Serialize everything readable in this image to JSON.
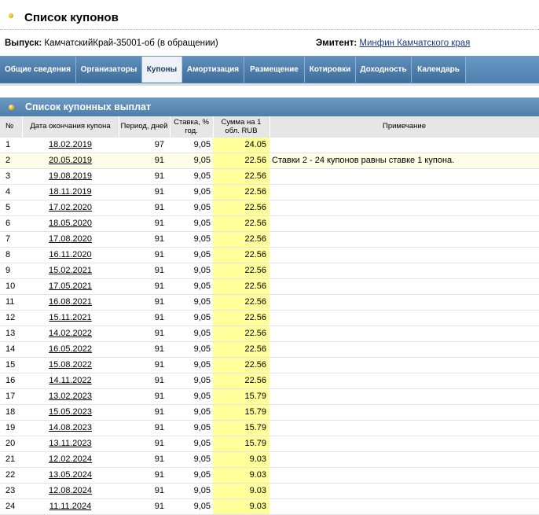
{
  "page": {
    "title": "Список купонов",
    "issue_label": "Выпуск:",
    "issue_value": "КамчатскийКрай-35001-об (в обращении)",
    "issuer_label": "Эмитент:",
    "issuer_link": "Минфин Камчатского края"
  },
  "tabs": [
    {
      "label": "Общие сведения",
      "active": false
    },
    {
      "label": "Организаторы",
      "active": false
    },
    {
      "label": "Купоны",
      "active": true
    },
    {
      "label": "Амортизация",
      "active": false
    },
    {
      "label": "Размещение",
      "active": false
    },
    {
      "label": "Котировки",
      "active": false
    },
    {
      "label": "Доходность",
      "active": false
    },
    {
      "label": "Календарь",
      "active": false
    }
  ],
  "section": {
    "title": "Список купонных выплат"
  },
  "table": {
    "headers": {
      "num": "№",
      "date": "Дата окончания купона",
      "period": "Период, дней",
      "rate": "Ставка, % год.",
      "sum": "Сумма на 1 обл. RUB",
      "note": "Примечание"
    },
    "rows": [
      {
        "num": "1",
        "date": "18.02.2019",
        "period": "97",
        "rate": "9,05",
        "sum": "24.05",
        "note": ""
      },
      {
        "num": "2",
        "date": "20.05.2019",
        "period": "91",
        "rate": "9,05",
        "sum": "22.56",
        "note": "Ставки 2 - 24 купонов равны ставке 1 купона."
      },
      {
        "num": "3",
        "date": "19.08.2019",
        "period": "91",
        "rate": "9,05",
        "sum": "22.56",
        "note": ""
      },
      {
        "num": "4",
        "date": "18.11.2019",
        "period": "91",
        "rate": "9,05",
        "sum": "22.56",
        "note": ""
      },
      {
        "num": "5",
        "date": "17.02.2020",
        "period": "91",
        "rate": "9,05",
        "sum": "22.56",
        "note": ""
      },
      {
        "num": "6",
        "date": "18.05.2020",
        "period": "91",
        "rate": "9,05",
        "sum": "22.56",
        "note": ""
      },
      {
        "num": "7",
        "date": "17.08.2020",
        "period": "91",
        "rate": "9,05",
        "sum": "22.56",
        "note": ""
      },
      {
        "num": "8",
        "date": "16.11.2020",
        "period": "91",
        "rate": "9,05",
        "sum": "22.56",
        "note": ""
      },
      {
        "num": "9",
        "date": "15.02.2021",
        "period": "91",
        "rate": "9,05",
        "sum": "22.56",
        "note": ""
      },
      {
        "num": "10",
        "date": "17.05.2021",
        "period": "91",
        "rate": "9,05",
        "sum": "22.56",
        "note": ""
      },
      {
        "num": "11",
        "date": "16.08.2021",
        "period": "91",
        "rate": "9,05",
        "sum": "22.56",
        "note": ""
      },
      {
        "num": "12",
        "date": "15.11.2021",
        "period": "91",
        "rate": "9,05",
        "sum": "22.56",
        "note": ""
      },
      {
        "num": "13",
        "date": "14.02.2022",
        "period": "91",
        "rate": "9,05",
        "sum": "22.56",
        "note": ""
      },
      {
        "num": "14",
        "date": "16.05.2022",
        "period": "91",
        "rate": "9,05",
        "sum": "22.56",
        "note": ""
      },
      {
        "num": "15",
        "date": "15.08.2022",
        "period": "91",
        "rate": "9,05",
        "sum": "22.56",
        "note": ""
      },
      {
        "num": "16",
        "date": "14.11.2022",
        "period": "91",
        "rate": "9,05",
        "sum": "22.56",
        "note": ""
      },
      {
        "num": "17",
        "date": "13.02.2023",
        "period": "91",
        "rate": "9,05",
        "sum": "15.79",
        "note": ""
      },
      {
        "num": "18",
        "date": "15.05.2023",
        "period": "91",
        "rate": "9,05",
        "sum": "15.79",
        "note": ""
      },
      {
        "num": "19",
        "date": "14.08.2023",
        "period": "91",
        "rate": "9,05",
        "sum": "15.79",
        "note": ""
      },
      {
        "num": "20",
        "date": "13.11.2023",
        "period": "91",
        "rate": "9,05",
        "sum": "15.79",
        "note": ""
      },
      {
        "num": "21",
        "date": "12.02.2024",
        "period": "91",
        "rate": "9,05",
        "sum": "9.03",
        "note": ""
      },
      {
        "num": "22",
        "date": "13.05.2024",
        "period": "91",
        "rate": "9,05",
        "sum": "9.03",
        "note": ""
      },
      {
        "num": "23",
        "date": "12.08.2024",
        "period": "91",
        "rate": "9,05",
        "sum": "9.03",
        "note": ""
      },
      {
        "num": "24",
        "date": "11.11.2024",
        "period": "91",
        "rate": "9,05",
        "sum": "9.03",
        "note": ""
      }
    ]
  },
  "colors": {
    "tab_bar": "#4d7fae",
    "active_tab": "#eef2f7",
    "sum_highlight": "#ffff99",
    "row_highlight": "#fdfde8",
    "link": "#1a3c8c"
  }
}
